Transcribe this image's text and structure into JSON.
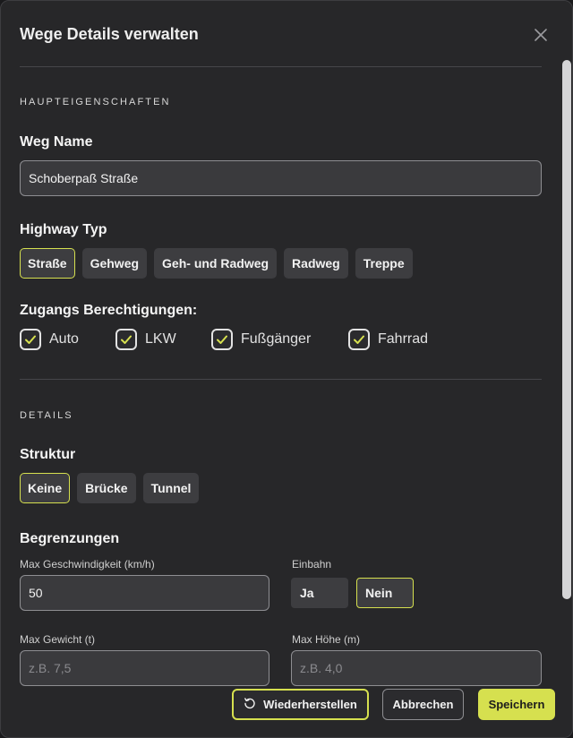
{
  "dialog": {
    "title": "Wege Details verwalten",
    "close_icon": "close-icon"
  },
  "main_section": {
    "label": "HAUPTEIGENSCHAFTEN",
    "name_field": {
      "label": "Weg Name",
      "value": "Schoberpaß Straße"
    },
    "highway_type": {
      "label": "Highway Typ",
      "options": [
        "Straße",
        "Gehweg",
        "Geh- und Radweg",
        "Radweg",
        "Treppe"
      ],
      "selected": "Straße"
    },
    "access": {
      "label": "Zugangs Berechtigungen:",
      "items": [
        {
          "label": "Auto",
          "checked": true
        },
        {
          "label": "LKW",
          "checked": true
        },
        {
          "label": "Fußgänger",
          "checked": true
        },
        {
          "label": "Fahrrad",
          "checked": true
        }
      ]
    }
  },
  "details_section": {
    "label": "DETAILS",
    "structure": {
      "label": "Struktur",
      "options": [
        "Keine",
        "Brücke",
        "Tunnel"
      ],
      "selected": "Keine"
    },
    "limits": {
      "label": "Begrenzungen",
      "max_speed": {
        "label": "Max Geschwindigkeit (km/h)",
        "value": "50"
      },
      "oneway": {
        "label": "Einbahn",
        "options": [
          "Ja",
          "Nein"
        ],
        "selected": "Nein"
      },
      "max_weight": {
        "label": "Max Gewicht (t)",
        "value": "",
        "placeholder": "z.B. 7,5"
      },
      "max_height": {
        "label": "Max Höhe (m)",
        "value": "",
        "placeholder": "z.B. 4,0"
      }
    }
  },
  "footer": {
    "reset_label": "Wiederherstellen",
    "cancel_label": "Abbrechen",
    "save_label": "Speichern"
  },
  "colors": {
    "accent": "#d6e04f",
    "background": "#272729",
    "chip": "#3d3d40"
  }
}
